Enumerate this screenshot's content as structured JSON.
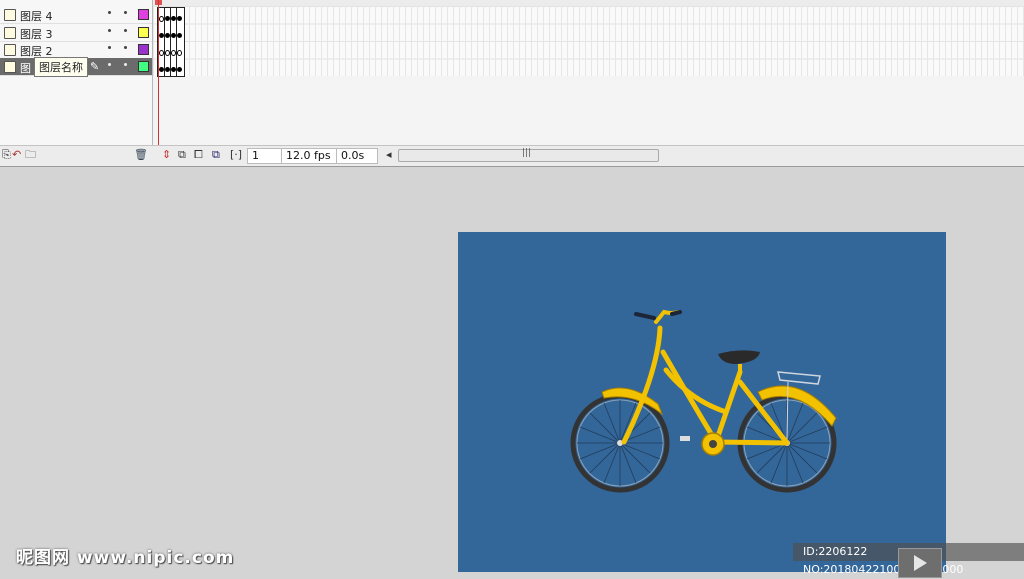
{
  "layers": [
    {
      "name": "图层 4",
      "color": "#e040e0"
    },
    {
      "name": "图层 3",
      "color": "#ffff50"
    },
    {
      "name": "图层 2",
      "color": "#9933cc"
    },
    {
      "name": "图",
      "color": "#40ff80"
    }
  ],
  "tooltip": "图层名称",
  "timeline_toolbar": {
    "current_frame": "1",
    "frame_rate": "12.0 fps",
    "elapsed_time": "0.0s"
  },
  "colors": {
    "stage_background": "#336699",
    "bike_frame": "#f2c200",
    "tire": "#333333"
  },
  "watermark": {
    "site": "昵图网 www.nipic.com",
    "id_text": "ID:2206122 NO:20180422100727332000"
  }
}
